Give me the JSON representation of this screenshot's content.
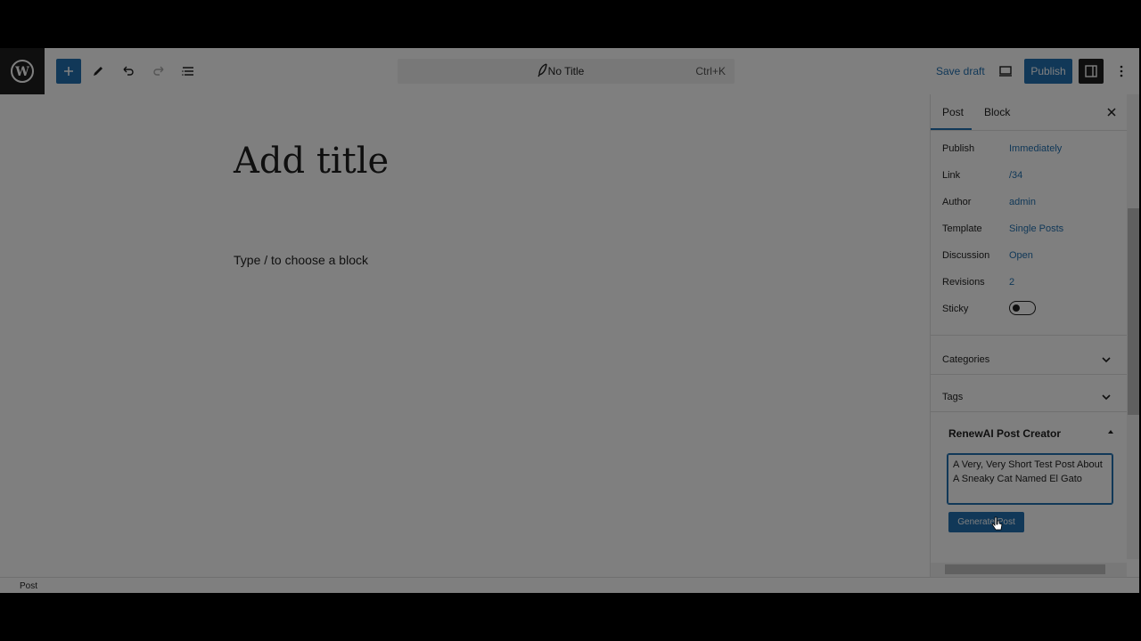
{
  "toolbar": {
    "command_title": "No Title",
    "command_shortcut": "Ctrl+K",
    "save_draft": "Save draft",
    "publish": "Publish"
  },
  "editor": {
    "title_placeholder": "Add title",
    "block_placeholder": "Type / to choose a block"
  },
  "sidebar": {
    "tabs": [
      "Post",
      "Block"
    ],
    "rows": [
      {
        "label": "Publish",
        "value": "Immediately"
      },
      {
        "label": "Link",
        "value": "/34"
      },
      {
        "label": "Author",
        "value": "admin"
      },
      {
        "label": "Template",
        "value": "Single Posts"
      },
      {
        "label": "Discussion",
        "value": "Open"
      },
      {
        "label": "Revisions",
        "value": "2"
      },
      {
        "label": "Sticky",
        "value": ""
      }
    ],
    "panels": [
      "Categories",
      "Tags"
    ],
    "ai": {
      "title": "RenewAI Post Creator",
      "prompt": "A Very, Very Short Test Post About A Sneaky Cat Named El Gato",
      "button": "Generate Post"
    }
  },
  "footer": {
    "breadcrumb": "Post"
  },
  "colors": {
    "accent": "#2271b1",
    "dark": "#1e1e1e"
  },
  "icons": [
    "wordpress-logo-icon",
    "plus-icon",
    "pencil-icon",
    "undo-icon",
    "redo-icon",
    "list-view-icon",
    "feather-icon",
    "preview-icon",
    "settings-panel-icon",
    "more-vertical-icon",
    "close-icon",
    "chevron-down-icon",
    "chevron-up-icon"
  ]
}
